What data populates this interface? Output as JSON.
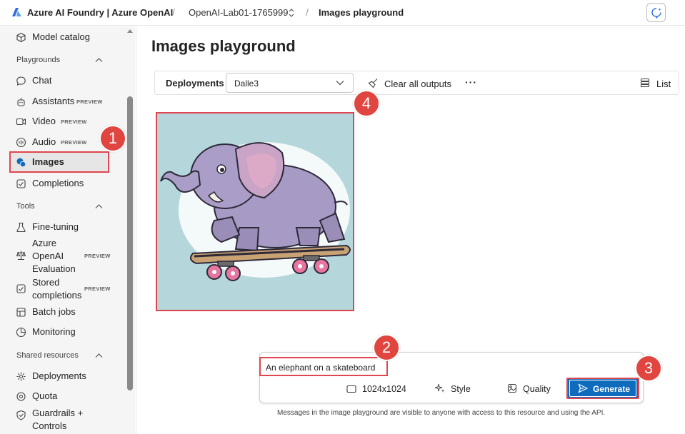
{
  "header": {
    "brand": "Azure AI Foundry | Azure OpenAI",
    "project": "OpenAI-Lab01-1765999",
    "page": "Images playground"
  },
  "sidebar": {
    "model_catalog": "Model catalog",
    "playgrounds": {
      "title": "Playgrounds",
      "items": [
        {
          "label": "Chat"
        },
        {
          "label": "Assistants",
          "badge": "PREVIEW"
        },
        {
          "label": "Video",
          "badge": "PREVIEW"
        },
        {
          "label": "Audio",
          "badge": "PREVIEW"
        },
        {
          "label": "Images"
        },
        {
          "label": "Completions"
        }
      ]
    },
    "tools": {
      "title": "Tools",
      "items": [
        {
          "label": "Fine-tuning"
        },
        {
          "label_lines": [
            "Azure",
            "OpenAI",
            "Evaluation"
          ],
          "badge": "PREVIEW"
        },
        {
          "label_lines": [
            "Stored",
            "completions"
          ],
          "badge": "PREVIEW"
        },
        {
          "label": "Batch jobs"
        },
        {
          "label": "Monitoring"
        }
      ]
    },
    "shared": {
      "title": "Shared resources",
      "items": [
        {
          "label": "Deployments"
        },
        {
          "label": "Quota"
        },
        {
          "label_lines": [
            "Guardrails +",
            "Controls"
          ]
        }
      ]
    }
  },
  "main": {
    "title": "Images playground",
    "toolbar": {
      "deployments_label": "Deployments",
      "deployment_value": "Dalle3",
      "clear_label": "Clear all outputs",
      "more_label": "···",
      "list_label": "List"
    },
    "prompt": {
      "text": "An elephant on a skateboard",
      "size": "1024x1024",
      "style": "Style",
      "quality": "Quality",
      "generate": "Generate"
    },
    "footnote": "Messages in the image playground are visible to anyone with access to this resource and using the API."
  },
  "markers": [
    "1",
    "2",
    "3",
    "4"
  ],
  "colors": {
    "accent": "#0f6cbd",
    "marker": "#e0453f",
    "highlight_border": "#e0464f"
  }
}
